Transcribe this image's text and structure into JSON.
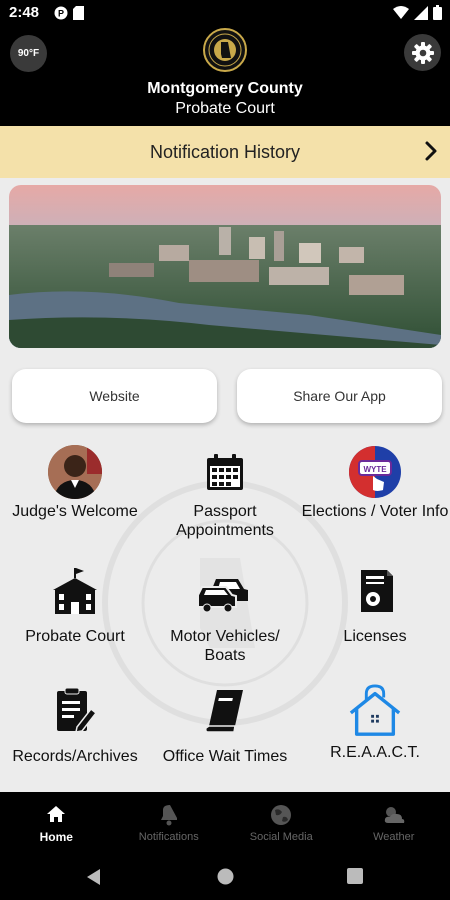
{
  "status_bar": {
    "time": "2:48"
  },
  "header": {
    "temperature": "90°F",
    "title": "Montgomery County",
    "subtitle": "Probate Court"
  },
  "notification_bar": {
    "label": "Notification History"
  },
  "buttons": {
    "website": "Website",
    "share": "Share Our App"
  },
  "grid": [
    {
      "label": "Judge's Welcome",
      "icon": "judge-photo"
    },
    {
      "label": "Passport Appointments",
      "icon": "calendar-icon"
    },
    {
      "label": "Elections / Voter Info",
      "icon": "vote-icon"
    },
    {
      "label": "Probate Court",
      "icon": "courthouse-icon"
    },
    {
      "label": "Motor Vehicles/ Boats",
      "icon": "car-icon"
    },
    {
      "label": "Licenses",
      "icon": "license-icon"
    },
    {
      "label": "Records/Archives",
      "icon": "records-icon"
    },
    {
      "label": "Office Wait Times",
      "icon": "book-icon"
    },
    {
      "label": "R.E.A.A.C.T.",
      "icon": "home-lock-icon"
    }
  ],
  "bottom_nav": [
    {
      "label": "Home",
      "icon": "home-icon",
      "active": true
    },
    {
      "label": "Notifications",
      "icon": "bell-icon",
      "active": false
    },
    {
      "label": "Social Media",
      "icon": "globe-icon",
      "active": false
    },
    {
      "label": "Weather",
      "icon": "weather-icon",
      "active": false
    }
  ],
  "colors": {
    "header": "#000000",
    "notification_bar": "#f4e1aa",
    "accent_blue": "#1e88e5",
    "vote_red": "#d32f2f"
  }
}
